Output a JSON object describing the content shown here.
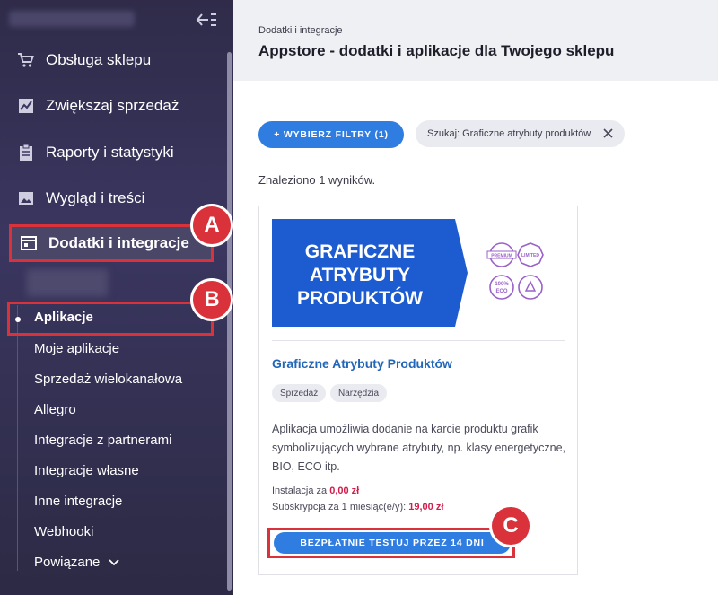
{
  "sidebar": {
    "items": [
      {
        "label": "Obsługa sklepu",
        "icon": "cart-icon"
      },
      {
        "label": "Zwiększaj sprzedaż",
        "icon": "chart-icon"
      },
      {
        "label": "Raporty i statystyki",
        "icon": "clipboard-icon"
      },
      {
        "label": "Wygląd i treści",
        "icon": "image-icon"
      },
      {
        "label": "Dodatki i integracje",
        "icon": "window-icon"
      }
    ],
    "sub_items": [
      {
        "label": "Aplikacje"
      },
      {
        "label": "Moje aplikacje"
      },
      {
        "label": "Sprzedaż wielokanałowa"
      },
      {
        "label": "Allegro"
      },
      {
        "label": "Integracje z partnerami"
      },
      {
        "label": "Integracje własne"
      },
      {
        "label": "Inne integracje"
      },
      {
        "label": "Webhooki"
      },
      {
        "label": "Powiązane"
      }
    ]
  },
  "badges": {
    "a": "A",
    "b": "B",
    "c": "C"
  },
  "header": {
    "breadcrumb": "Dodatki i integracje",
    "title": "Appstore - dodatki i aplikacje dla Twojego sklepu"
  },
  "filters": {
    "button_label": "+ WYBIERZ FILTRY (1)",
    "chip_label": "Szukaj: Graficzne atrybuty produktów"
  },
  "results": {
    "found_text": "Znaleziono 1 wyników."
  },
  "app_card": {
    "banner_line1": "GRAFICZNE",
    "banner_line2": "ATRYBUTY",
    "banner_line3": "PRODUKTÓW",
    "badge_premium": "PREMIUM",
    "badge_limited": "LIMITED",
    "badge_eco_pct": "100%",
    "badge_eco": "ECO",
    "title": "Graficzne Atrybuty Produktów",
    "tags": [
      "Sprzedaż",
      "Narzędzia"
    ],
    "description": "Aplikacja umożliwia dodanie na karcie produktu grafik symbolizujących wybrane atrybuty, np. klasy energetyczne, BIO, ECO itp.",
    "install_label": "Instalacja za",
    "install_price": "0,00 zł",
    "subscription_label": "Subskrypcja za 1 miesiąc(e/y):",
    "subscription_price": "19,00 zł",
    "cta_label": "BEZPŁATNIE TESTUJ PRZEZ 14 DNI"
  },
  "colors": {
    "accent": "#2f7de1",
    "highlight": "#d9323b",
    "price": "#d21d4a",
    "sidebar": "#2f2b49"
  }
}
